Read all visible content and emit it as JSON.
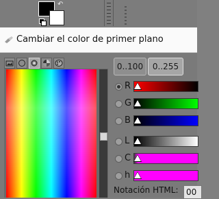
{
  "dialog": {
    "title": "Cambiar el color de primer plano"
  },
  "range_buttons": [
    {
      "label": "0..100",
      "active": false
    },
    {
      "label": "0..255",
      "active": true
    }
  ],
  "channels": [
    {
      "label": "R",
      "selected": true,
      "gradient": [
        "#ff0000",
        "#000000"
      ]
    },
    {
      "label": "G",
      "selected": false,
      "gradient": [
        "#000000",
        "#00ff00"
      ]
    },
    {
      "label": "B",
      "selected": false,
      "gradient": [
        "#000000",
        "#0000ff"
      ]
    },
    {
      "label": "L",
      "selected": false,
      "gradient": [
        "#000000",
        "#ffffff"
      ]
    },
    {
      "label": "C",
      "selected": false,
      "gradient": [
        "#ff00ff",
        "#ff00ff"
      ]
    },
    {
      "label": "h",
      "selected": false,
      "gradient": [
        "#ff00ff",
        "#ff00ff"
      ]
    }
  ],
  "notation": {
    "label": "Notación HTML:",
    "value": "00"
  },
  "icons": {
    "dialog": "paint-brush-icon",
    "tabs": [
      "image-icon",
      "circle-icon",
      "gimp-icon",
      "color-wheel-icon",
      "palette-icon"
    ]
  },
  "colors": {
    "foreground": "#000000",
    "background": "#ffffff"
  }
}
